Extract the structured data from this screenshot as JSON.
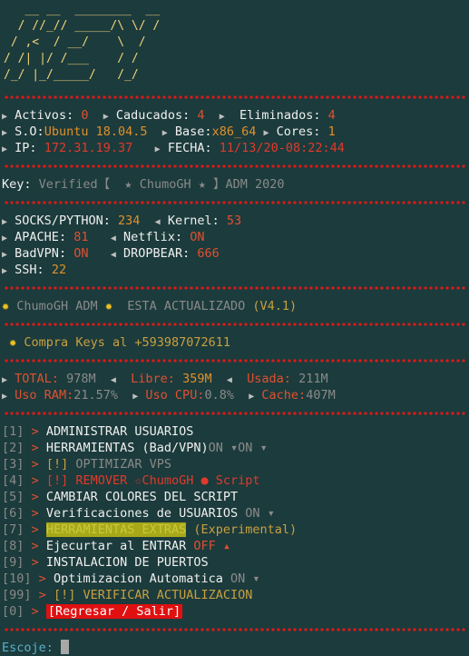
{
  "banner": [
    "   __ __  ________  __",
    "  / //_// _____/\\ \\/ /",
    " / ,<  / __/    \\  /",
    "/ /| |/ /___    / /",
    "/_/ |_/_____/   /_/"
  ],
  "status": {
    "activos_label": "Activos:",
    "activos_value": "0",
    "caducados_label": "Caducados:",
    "caducados_value": "4",
    "eliminados_label": "Eliminados:",
    "eliminados_value": "4",
    "so_label": "S.O:",
    "so_value": "Ubuntu 18.04.5",
    "base_label": "Base:",
    "base_value": "x86_64",
    "cores_label": "Cores:",
    "cores_value": "1",
    "ip_label": "IP:",
    "ip_value": "172.31.19.37",
    "fecha_label": "FECHA:",
    "fecha_value": "11/13/20-08:22:44"
  },
  "key": {
    "label": "Key:",
    "value": "Verified【  ★ ChumoGH ★ 】ADM 2020"
  },
  "services": {
    "socks_label": "SOCKS/PYTHON:",
    "socks_value": "234",
    "kernel_label": "Kernel:",
    "kernel_value": "53",
    "apache_label": "APACHE:",
    "apache_value": "81",
    "netflix_label": "Netflix:",
    "netflix_value": "ON",
    "badvpn_label": "BadVPN:",
    "badvpn_value": "ON",
    "dropbear_label": "DROPBEAR:",
    "dropbear_value": "666",
    "ssh_label": "SSH:",
    "ssh_value": "22"
  },
  "update": {
    "brand": "ChumoGH ADM",
    "text": "ESTA ACTUALIZADO",
    "version": "(V4.1)"
  },
  "buy": {
    "text": "Compra Keys al",
    "phone": "+593987072611"
  },
  "resources": {
    "total_label": "TOTAL:",
    "total_value": "978M",
    "libre_label": "Libre:",
    "libre_value": "359M",
    "usada_label": "Usada:",
    "usada_value": "211M",
    "ram_label": "Uso RAM:",
    "ram_value": "21.57%",
    "cpu_label": "Uso CPU:",
    "cpu_value": "0.8%",
    "cache_label": "Cache:",
    "cache_value": "407M"
  },
  "menu": {
    "i1": {
      "num": "[1]",
      "label": "ADMINISTRAR USUARIOS"
    },
    "i2": {
      "num": "[2]",
      "label": "HERRAMIENTAS (Bad/VPN)",
      "s1": "ON",
      "s2": "ON"
    },
    "i3": {
      "num": "[3]",
      "tag": "[!]",
      "label": "OPTIMIZAR VPS"
    },
    "i4": {
      "num": "[4]",
      "tag": "[!]",
      "label": "REMOVER ☆ChumoGH ● Script"
    },
    "i5": {
      "num": "[5]",
      "label": "CAMBIAR COLORES DEL SCRIPT"
    },
    "i6": {
      "num": "[6]",
      "label": "Verificaciones de USUARIOS",
      "s1": "ON"
    },
    "i7": {
      "num": "[7]",
      "label": "HERRAMIENTAS EXTRAS",
      "extra": "(Experimental)"
    },
    "i8": {
      "num": "[8]",
      "label": "Ejecurtar al ENTRAR",
      "s1": "OFF"
    },
    "i9": {
      "num": "[9]",
      "label": "INSTALACION DE PUERTOS"
    },
    "i10": {
      "num": "[10]",
      "label": "Optimizacion Automatica",
      "s1": "ON"
    },
    "i99": {
      "num": "[99]",
      "tag": "[!]",
      "label": "VERIFICAR ACTUALIZACION"
    },
    "i0": {
      "num": "[0]",
      "label": "[Regresar / Salir]"
    },
    "gt": ">"
  },
  "prompt": {
    "label": "Escoje:"
  }
}
